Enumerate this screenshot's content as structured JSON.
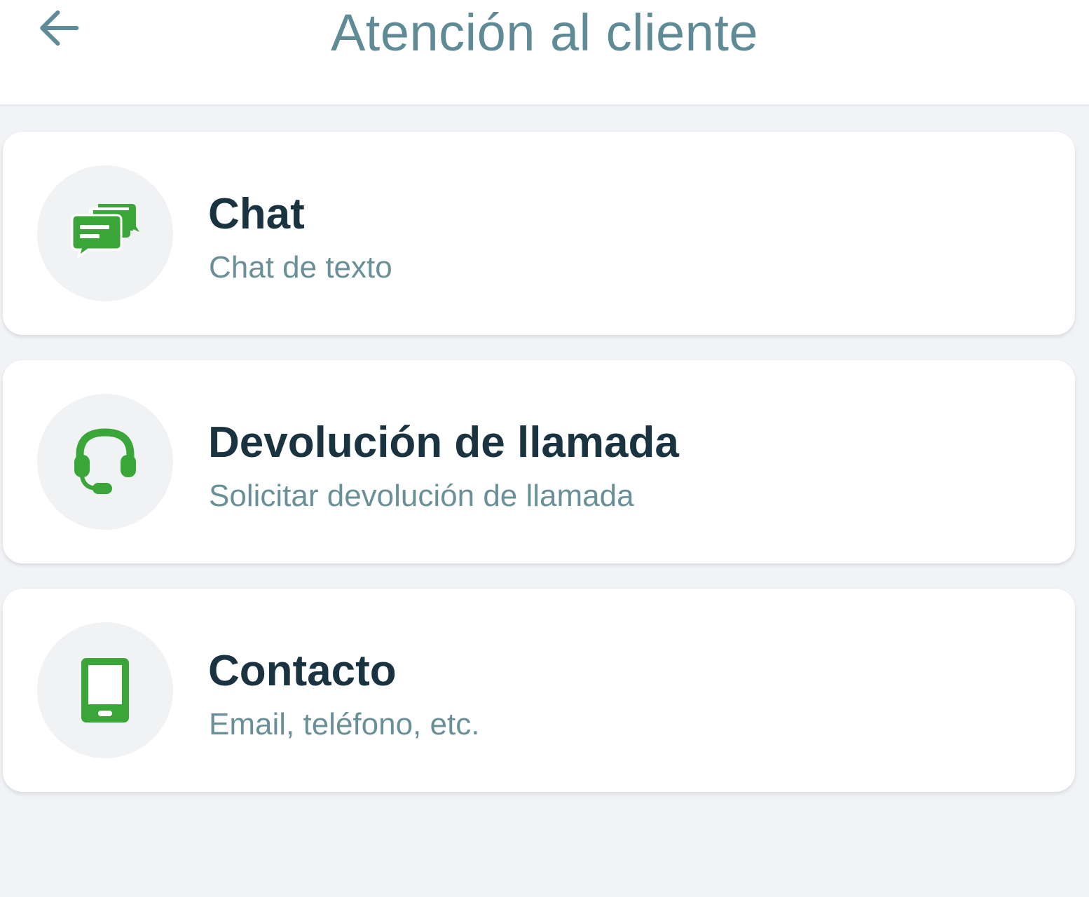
{
  "header": {
    "title": "Atención al cliente",
    "back_icon": "arrow-left-icon"
  },
  "colors": {
    "title": "#5f8b96",
    "accent_green": "#3aa63a",
    "card_title": "#1a3340",
    "card_subtitle": "#6a9097",
    "background": "#f1f3f7"
  },
  "options": [
    {
      "title": "Chat",
      "subtitle": "Chat de texto",
      "icon": "chat-bubbles-icon"
    },
    {
      "title": "Devolución de llamada",
      "subtitle": "Solicitar devolución de llamada",
      "icon": "headset-icon"
    },
    {
      "title": "Contacto",
      "subtitle": "Email, teléfono, etc.",
      "icon": "smartphone-icon"
    }
  ]
}
